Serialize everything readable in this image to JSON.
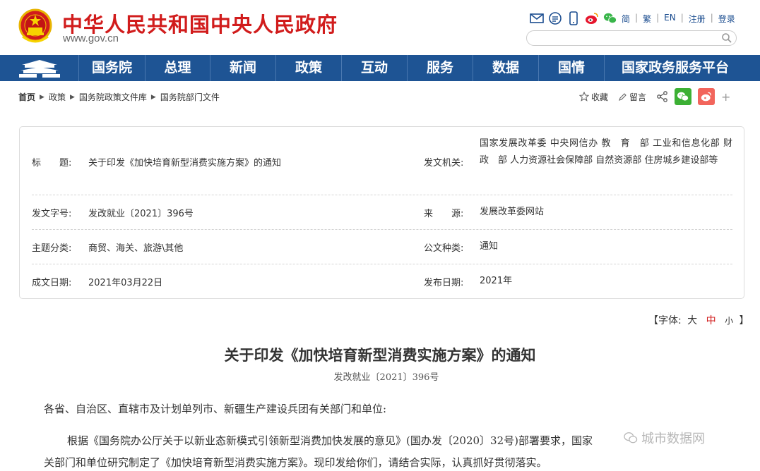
{
  "header": {
    "title": "中华人民共和国中央人民政府",
    "url": "www.gov.cn",
    "links": [
      "简",
      "繁",
      "EN",
      "注册",
      "登录"
    ],
    "search_placeholder": ""
  },
  "nav": {
    "items": [
      "国务院",
      "总理",
      "新闻",
      "政策",
      "互动",
      "服务",
      "数据",
      "国情",
      "国家政务服务平台"
    ]
  },
  "breadcrumb": [
    "首页",
    "政策",
    "国务院政策文件库",
    "国务院部门文件"
  ],
  "share": {
    "favorite": "收藏",
    "comment": "留言",
    "plus": "+"
  },
  "info": {
    "title_label": "标　　题:",
    "title_value": "关于印发《加快培育新型消费实施方案》的通知",
    "issuer_label": "发文机关:",
    "issuer_value": "国家发展改革委 中央网信办 教　育　部 工业和信息化部 财　政　部 人力资源社会保障部 自然资源部 住房城乡建设部等",
    "doc_no_label": "发文字号:",
    "doc_no_value": "发改就业〔2021〕396号",
    "source_label": "来　　源:",
    "source_value": "发展改革委网站",
    "topic_label": "主题分类:",
    "topic_value": "商贸、海关、旅游\\其他",
    "type_label": "公文种类:",
    "type_value": "通知",
    "date_label": "成文日期:",
    "date_value": "2021年03月22日",
    "pub_label": "发布日期:",
    "pub_value": "2021年"
  },
  "fontsize": {
    "prefix": "【字体:",
    "large": "大",
    "medium": "中",
    "small": "小",
    "suffix": "】"
  },
  "article": {
    "title": "关于印发《加快培育新型消费实施方案》的通知",
    "doc_no": "发改就业〔2021〕396号",
    "salutation": "各省、自治区、直辖市及计划单列市、新疆生产建设兵团有关部门和单位:",
    "para1_line1": "根据《国务院办公厅关于以新业态新模式引领新型消费加快发展的意见》(国办发〔2020〕32号)部署要求，国家",
    "para1_line2": "关部门和单位研究制定了《加快培育新型消费实施方案》。现印发给你们，请结合实际，认真抓好贯彻落实。"
  },
  "watermark": "城市数据网",
  "colors": {
    "brand_red": "#d11c1c",
    "nav_blue": "#1e5494"
  }
}
